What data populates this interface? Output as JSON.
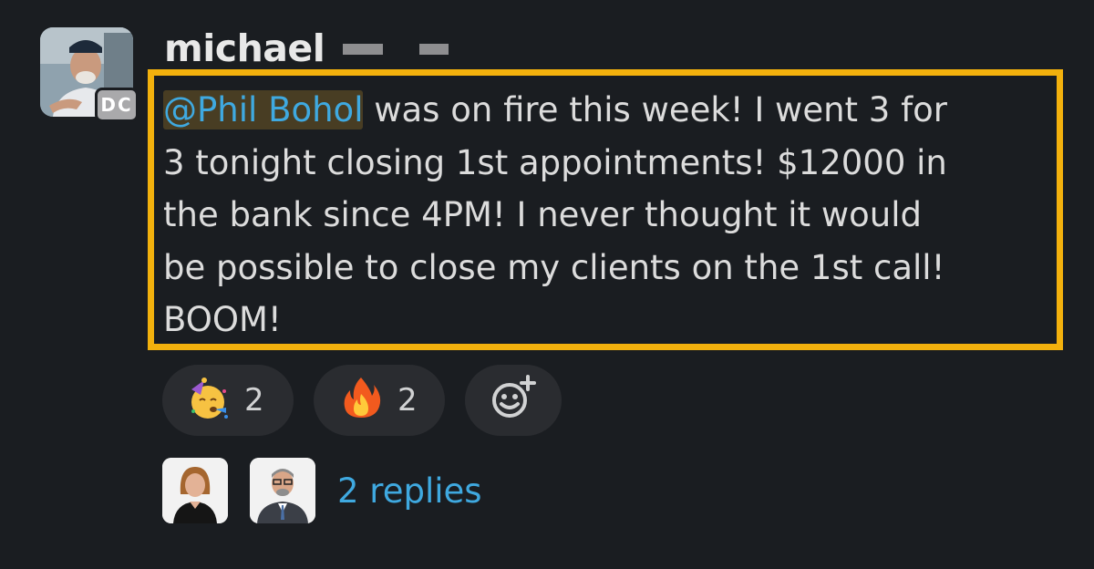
{
  "message": {
    "author": "michael",
    "avatar_badge": "DC",
    "mention": "@Phil Bohol",
    "body_lines": [
      " was on fire this week! I went 3 for",
      "3 tonight closing 1st appointments! $12000 in",
      "the bank since 4PM! I never thought it would",
      "be possible to close my clients on the 1st call!",
      "BOOM!"
    ]
  },
  "reactions": [
    {
      "icon": "partying-face-emoji",
      "count": "2"
    },
    {
      "icon": "fire-emoji",
      "count": "2"
    }
  ],
  "add_reaction_icon": "add-reaction-icon",
  "thread": {
    "replies_label": "2 replies",
    "participants": [
      "participant-avatar-woman",
      "participant-avatar-man"
    ]
  },
  "colors": {
    "background": "#1a1d21",
    "highlight_border": "#f3b10d",
    "mention_text": "#3fa9e0",
    "link": "#3fa9e0",
    "reaction_pill": "#2a2c30"
  }
}
